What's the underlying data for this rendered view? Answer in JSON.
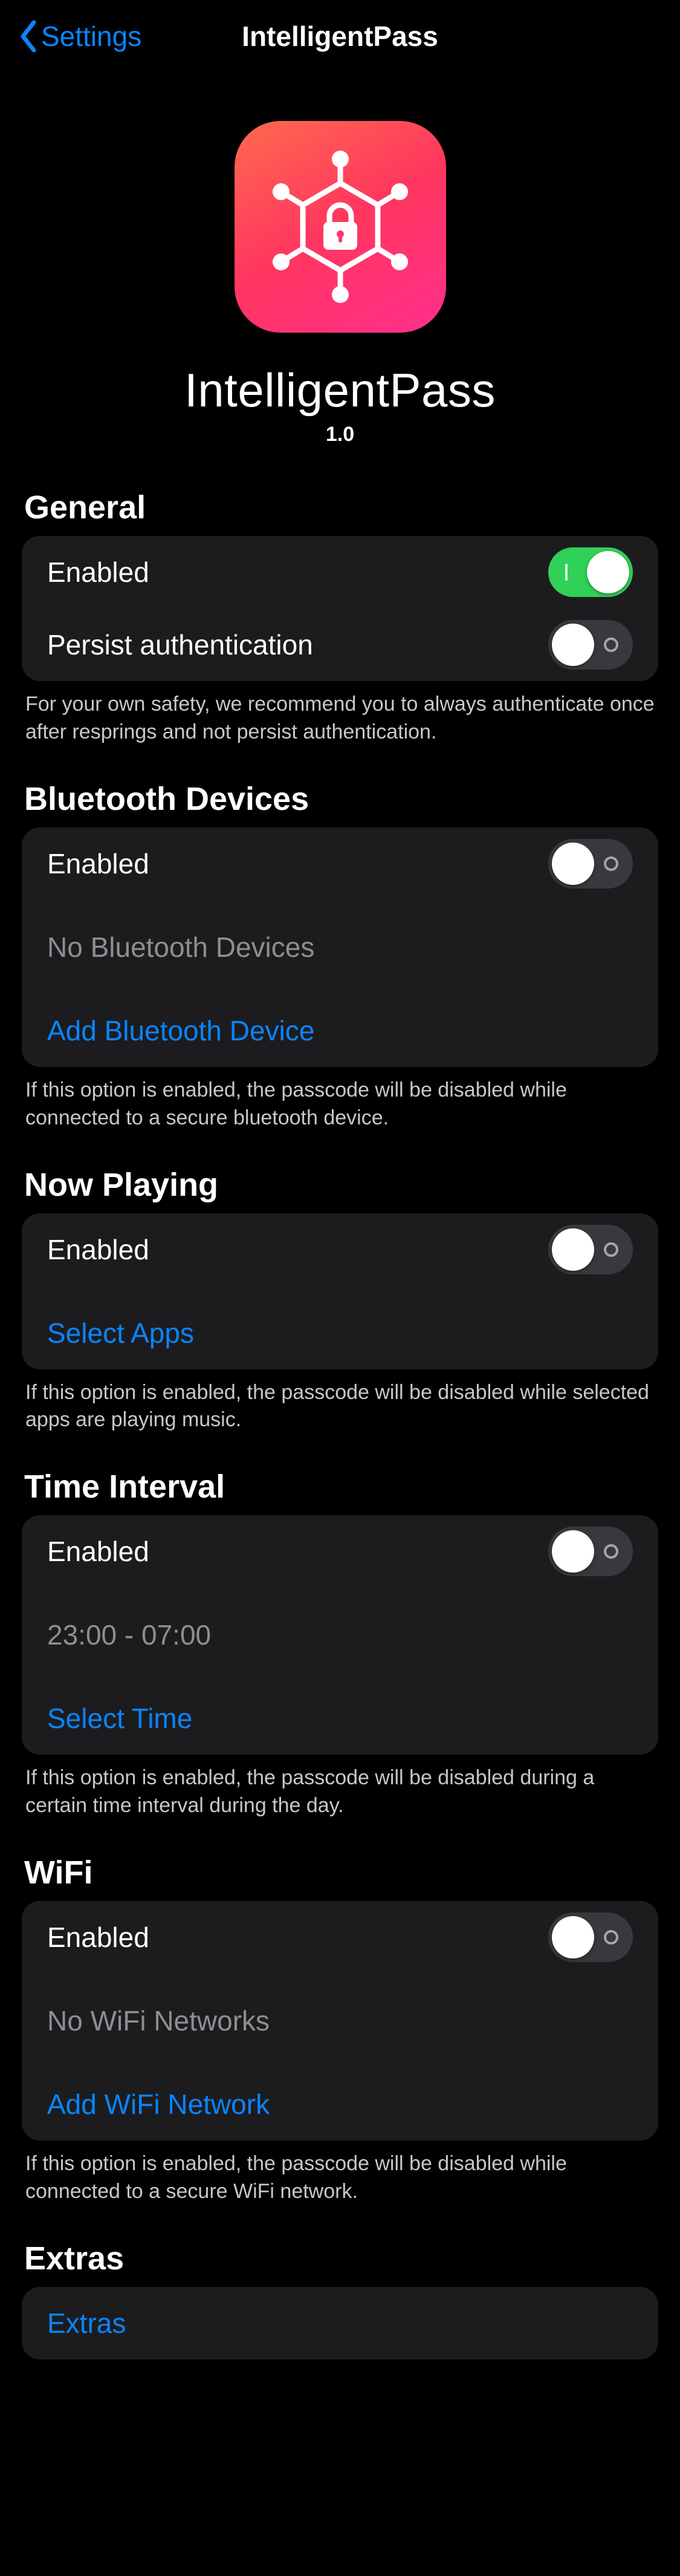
{
  "nav": {
    "back": "Settings",
    "title": "IntelligentPass"
  },
  "hero": {
    "name": "IntelligentPass",
    "version": "1.0"
  },
  "general": {
    "header": "General",
    "enabled_label": "Enabled",
    "enabled_on": true,
    "persist_label": "Persist authentication",
    "persist_on": false,
    "footer": "For your own safety, we recommend you to always authenticate once after resprings and not persist authentication."
  },
  "bluetooth": {
    "header": "Bluetooth Devices",
    "enabled_label": "Enabled",
    "enabled_on": false,
    "empty_label": "No Bluetooth Devices",
    "add_label": "Add Bluetooth Device",
    "footer": "If this option is enabled, the passcode will be disabled while connected to a secure bluetooth device."
  },
  "nowplaying": {
    "header": "Now Playing",
    "enabled_label": "Enabled",
    "enabled_on": false,
    "select_label": "Select Apps",
    "footer": "If this option is enabled, the passcode will be disabled while selected apps are playing music."
  },
  "timeinterval": {
    "header": "Time Interval",
    "enabled_label": "Enabled",
    "enabled_on": false,
    "range_label": "23:00 - 07:00",
    "select_label": "Select Time",
    "footer": "If this option is enabled, the passcode will be disabled during a certain time interval during the day."
  },
  "wifi": {
    "header": "WiFi",
    "enabled_label": "Enabled",
    "enabled_on": false,
    "empty_label": "No WiFi Networks",
    "add_label": "Add WiFi Network",
    "footer": "If this option is enabled, the passcode will be disabled while connected to a secure WiFi network."
  },
  "extras": {
    "header": "Extras",
    "link_label": "Extras"
  }
}
